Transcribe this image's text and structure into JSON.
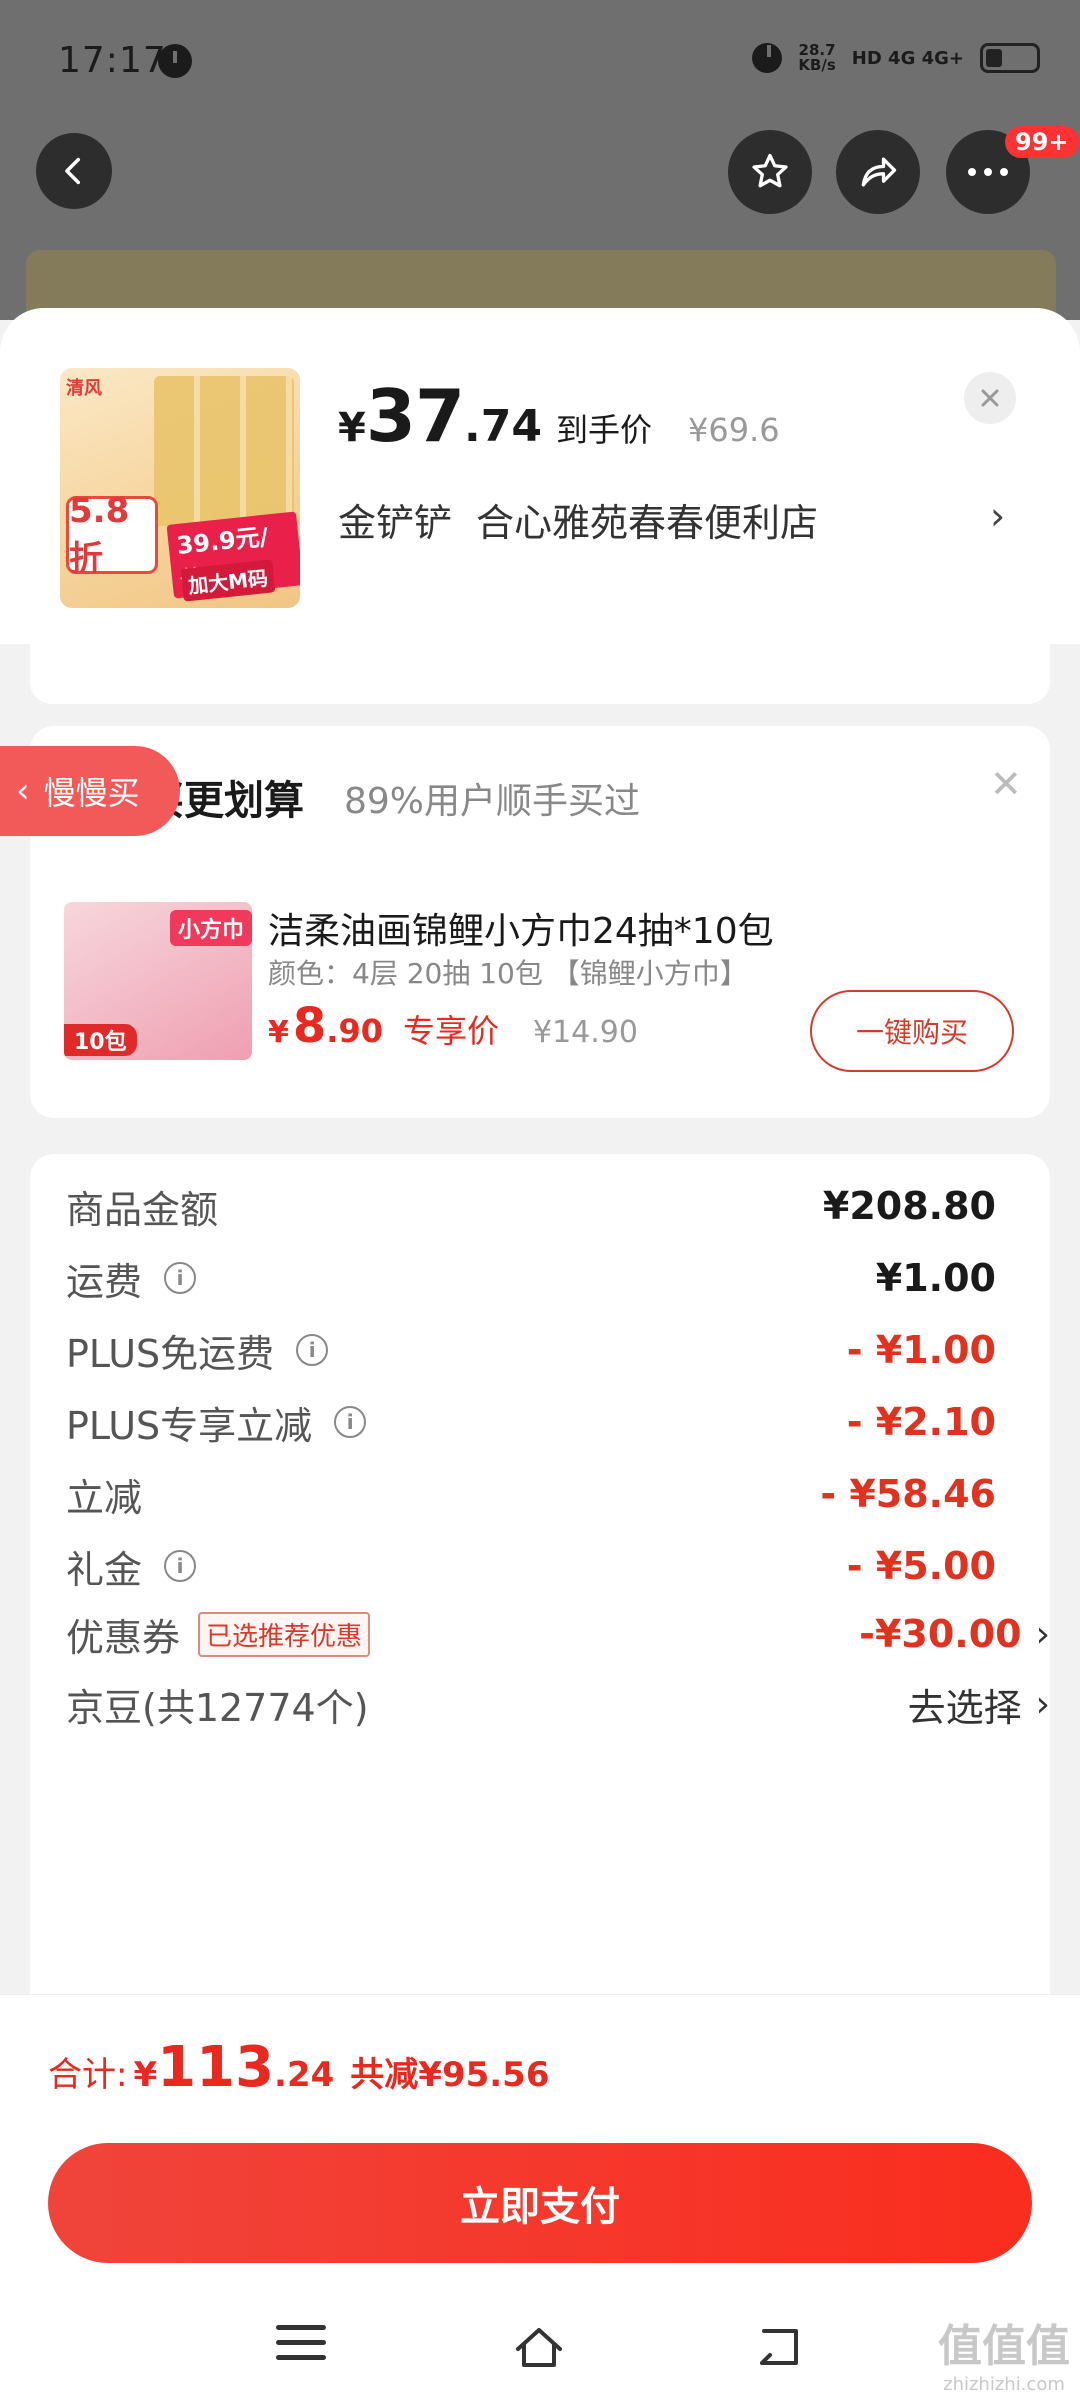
{
  "status_bar": {
    "time": "17:17",
    "net_speed_top": "28.7",
    "net_speed_bottom": "KB/s",
    "indicators": "HD 4G 4G+"
  },
  "background": {
    "more_badge": "99+"
  },
  "product": {
    "price_symbol": "¥",
    "price_int": "37",
    "price_dec": ".74",
    "price_label": "到手价",
    "original_price": "¥69.6",
    "shop_owner": "金铲铲",
    "shop_name": "合心雅苑春春便利店",
    "thumb_logo": "清风",
    "thumb_percent": "5.8折",
    "thumb_tag": "39.9元/件",
    "thumb_tag2": "加大M码"
  },
  "recommend": {
    "title": "买更划算",
    "subtitle": "89%用户顺手买过",
    "slow_tab": "慢慢买",
    "item_name": "洁柔油画锦鲤小方巾24抽*10包",
    "item_spec": "颜色：4层 20抽 10包 【锦鲤小方巾】",
    "price_symbol": "¥",
    "price_int": "8",
    "price_dec": ".90",
    "price_label": "专享价",
    "original_price": "¥14.90",
    "buy_label": "一键购买",
    "img_label": "小方巾",
    "img_count": "10包"
  },
  "summary": {
    "rows": [
      {
        "label": "商品金额",
        "value": "¥208.80"
      },
      {
        "label": "运费",
        "value": "¥1.00"
      },
      {
        "label": "PLUS免运费",
        "value": "- ¥1.00"
      },
      {
        "label": "PLUS专享立减",
        "value": "- ¥2.10"
      },
      {
        "label": "立减",
        "value": "- ¥58.46"
      },
      {
        "label": "礼金",
        "value": "- ¥5.00"
      },
      {
        "label": "优惠券",
        "value": "-¥30.00",
        "badge": "已选推荐优惠"
      },
      {
        "label": "京豆(共12774个)",
        "value": "去选择"
      }
    ]
  },
  "bottom": {
    "total_label": "合计:",
    "total_symbol": "¥",
    "total_int": "113",
    "total_dec": ".24",
    "savings": "共减¥95.56",
    "pay_label": "立即支付"
  },
  "watermark": {
    "text": "值值值",
    "url": "zhizhizhi.com"
  },
  "colors": {
    "accent": "#e8291f",
    "pay_button": "#f0443b",
    "slow_tab": "#f25a5a"
  }
}
